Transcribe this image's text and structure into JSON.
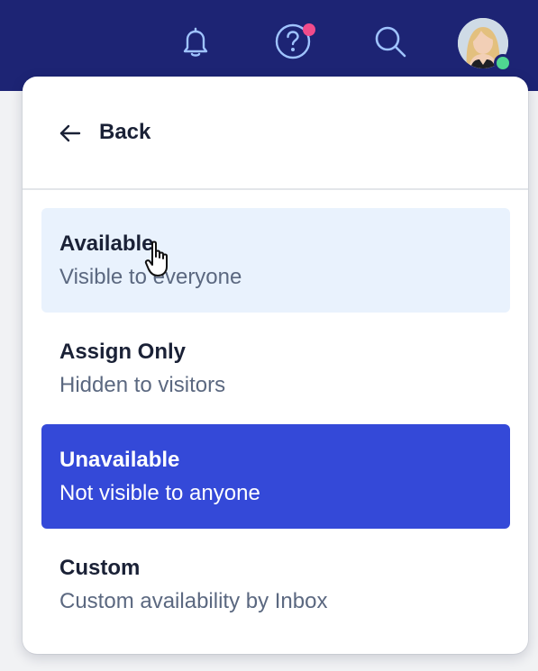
{
  "topbar": {
    "background_color": "#1d2474",
    "icons": [
      "bell-icon",
      "help-icon",
      "search-icon"
    ],
    "help_notification_color": "#f14b8b",
    "status_color": "#4fd691"
  },
  "menu": {
    "back_label": "Back",
    "selected_color": "#3449d8",
    "hover_color": "#e9f2fd",
    "options": [
      {
        "title": "Available",
        "subtitle": "Visible to everyone"
      },
      {
        "title": "Assign Only",
        "subtitle": "Hidden to visitors"
      },
      {
        "title": "Unavailable",
        "subtitle": "Not visible to anyone"
      },
      {
        "title": "Custom",
        "subtitle": "Custom availability by Inbox"
      }
    ]
  }
}
